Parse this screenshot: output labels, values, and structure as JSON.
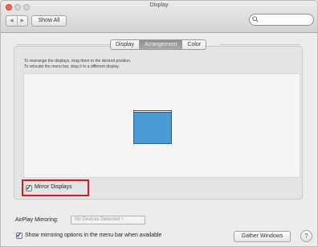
{
  "window": {
    "title": "Display"
  },
  "toolbar": {
    "back_label": "◀",
    "forward_label": "▶",
    "show_all_label": "Show All",
    "search_placeholder": ""
  },
  "tabs": [
    {
      "label": "Display",
      "active": false
    },
    {
      "label": "Arrangement",
      "active": true
    },
    {
      "label": "Color",
      "active": false
    }
  ],
  "arrangement": {
    "instruction_1": "To rearrange the displays, drag them to the desired position.",
    "instruction_2": "To relocate the menu bar, drag it to a different display."
  },
  "mirror": {
    "label": "Mirror Displays",
    "checked": true
  },
  "airplay": {
    "label": "AirPlay Mirroring:",
    "value": "No Devices Detected ÷"
  },
  "menubar_option": {
    "label": "Show mirroring options in the menu bar when available",
    "checked": true
  },
  "buttons": {
    "gather_windows": "Gather Windows",
    "help": "?"
  },
  "colors": {
    "display_fill": "#4a9bd4",
    "highlight": "#cc1f2a",
    "active_tab": "#9a9a9a"
  }
}
